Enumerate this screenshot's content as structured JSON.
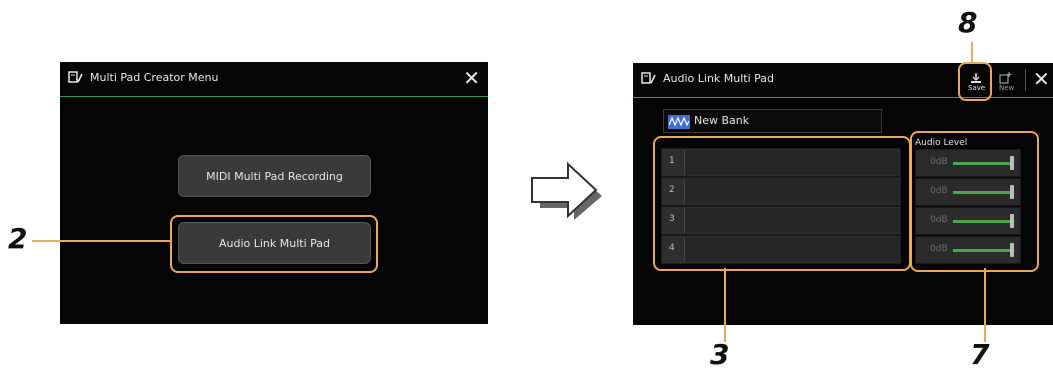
{
  "left_screen": {
    "title": "Multi Pad Creator Menu",
    "buttons": {
      "midi": "MIDI Multi Pad Recording",
      "audio": "Audio Link Multi Pad"
    }
  },
  "right_screen": {
    "title": "Audio Link Multi Pad",
    "toolbar": {
      "save": "Save",
      "new": "New"
    },
    "bank_name": "New Bank",
    "audio_level_header": "Audio Level",
    "pads": [
      "1",
      "2",
      "3",
      "4"
    ],
    "levels": [
      "0dB",
      "0dB",
      "0dB",
      "0dB"
    ]
  },
  "callouts": {
    "c2": "2",
    "c3": "3",
    "c7": "7",
    "c8": "8"
  },
  "colors": {
    "accent": "#2f9e55",
    "callout": "#e9a758",
    "level_bar": "#49a84f"
  }
}
